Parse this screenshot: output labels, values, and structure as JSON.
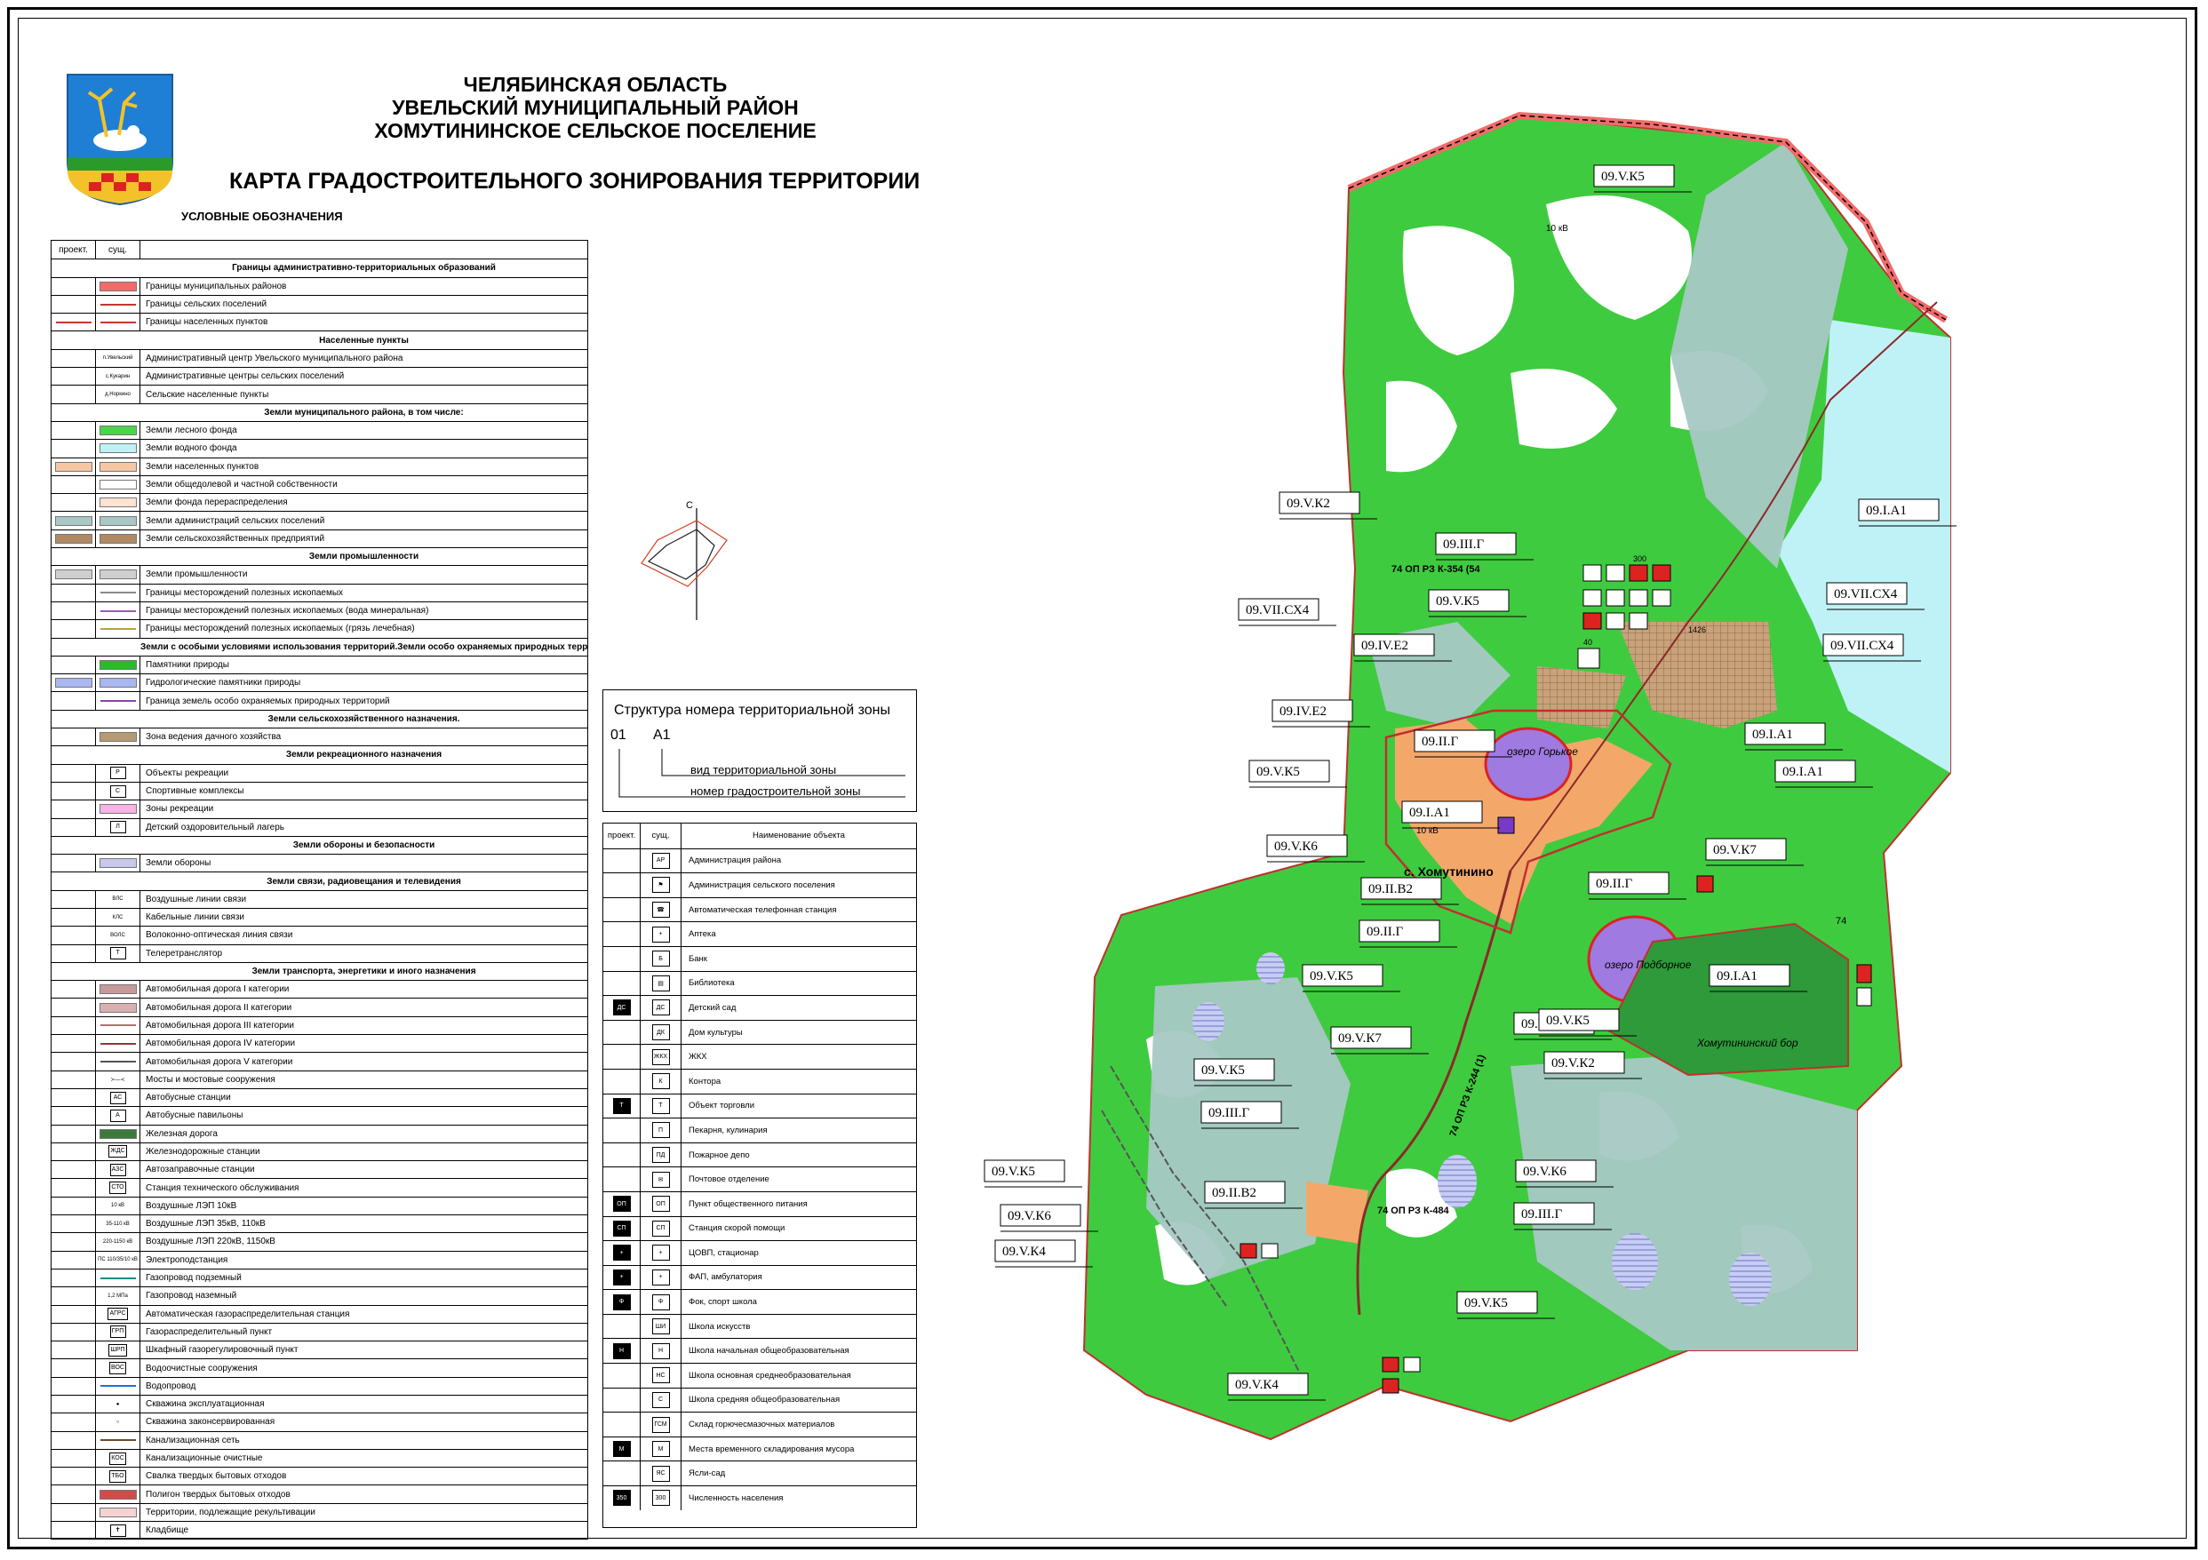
{
  "header": {
    "line1": "ЧЕЛЯБИНСКАЯ ОБЛАСТЬ",
    "line2": "УВЕЛЬСКИЙ МУНИЦИПАЛЬНЫЙ РАЙОН",
    "line3": "ХОМУТИНИНСКОЕ СЕЛЬСКОЕ ПОСЕЛЕНИЕ",
    "map_title": "КАРТА ГРАДОСТРОИТЕЛЬНОГО ЗОНИРОВАНИЯ ТЕРРИТОРИИ",
    "legend_caption": "УСЛОВНЫЕ ОБОЗНАЧЕНИЯ"
  },
  "legend": {
    "col_proj": "проект.",
    "col_exist": "сущ.",
    "rows": [
      {
        "type": "section",
        "label": "Границы административно-территориальных образований"
      },
      {
        "type": "item",
        "label": "Границы муниципальных районов",
        "sym": "swatch",
        "color": "#f26b6b"
      },
      {
        "type": "item",
        "label": "Границы сельских поселений",
        "sym": "line",
        "color": "#c0392b"
      },
      {
        "type": "item",
        "label": "Границы населенных пунктов",
        "sym": "line2",
        "color": "#c0392b"
      },
      {
        "type": "section",
        "label": "Населенные пункты"
      },
      {
        "type": "item",
        "label": "Административный центр Увельского муниципального района",
        "sym": "text",
        "text": "п.Увельский"
      },
      {
        "type": "item",
        "label": "Административные центры сельских поселений",
        "sym": "text",
        "text": "с.Кукарин"
      },
      {
        "type": "item",
        "label": "Сельские населенные пункты",
        "sym": "text",
        "text": "д.Норкино"
      },
      {
        "type": "section",
        "label": "Земли муниципального района, в том числе:"
      },
      {
        "type": "item",
        "label": "Земли лесного фонда",
        "sym": "swatch",
        "color": "#4cd44c"
      },
      {
        "type": "item",
        "label": "Земли водного фонда",
        "sym": "swatch",
        "color": "#bff2f6"
      },
      {
        "type": "item",
        "label": "Земли населенных пунктов",
        "sym": "swatch2",
        "color": "#f7c6a3"
      },
      {
        "type": "item",
        "label": "Земли общедолевой и частной собственности",
        "sym": "swatch",
        "color": "#ffffff"
      },
      {
        "type": "item",
        "label": "Земли фонда перераспределения",
        "sym": "swatch",
        "color": "#fde3d2"
      },
      {
        "type": "item",
        "label": "Земли администраций сельских поселений",
        "sym": "swatch2",
        "color": "#a7c8c4"
      },
      {
        "type": "item",
        "label": "Земли сельскохозяйственных предприятий",
        "sym": "swatch2",
        "color": "#b08a62"
      },
      {
        "type": "section",
        "label": "Земли промышленности"
      },
      {
        "type": "item",
        "label": "Земли промышленности",
        "sym": "swatch2",
        "color": "#cfcfcf"
      },
      {
        "type": "item",
        "label": "Границы месторождений полезных ископаемых",
        "sym": "line",
        "color": "#8a8a8a"
      },
      {
        "type": "item",
        "label": "Границы месторождений полезных ископаемых (вода минеральная)",
        "sym": "line",
        "color": "#9b59b6"
      },
      {
        "type": "item",
        "label": "Границы месторождений полезных ископаемых (грязь лечебная)",
        "sym": "line",
        "color": "#b7a33b"
      },
      {
        "type": "section",
        "label": "Земли с особыми условиями использования территорий.Земли особо охраняемых природных территорий."
      },
      {
        "type": "item",
        "label": "Памятники природы",
        "sym": "swatch",
        "color": "#2eb82e"
      },
      {
        "type": "item",
        "label": "Гидрологические памятники природы",
        "sym": "swatch2",
        "color": "#a9b8f2"
      },
      {
        "type": "item",
        "label": "Граница земель особо охраняемых природных территорий",
        "sym": "line",
        "color": "#8e44ad"
      },
      {
        "type": "section",
        "label": "Земли сельскохозяйственного назначения."
      },
      {
        "type": "item",
        "label": "Зона ведения дачного хозяйства",
        "sym": "swatch",
        "color": "#b79a73"
      },
      {
        "type": "section",
        "label": "Земли рекреационного назначения"
      },
      {
        "type": "item",
        "label": "Объекты рекреации",
        "sym": "icon",
        "text": "Р"
      },
      {
        "type": "item",
        "label": "Спортивные комплексы",
        "sym": "icon",
        "text": "С"
      },
      {
        "type": "item",
        "label": "Зоны рекреации",
        "sym": "swatch",
        "color": "#f6b3e3"
      },
      {
        "type": "item",
        "label": "Детский оздоровительный лагерь",
        "sym": "icon",
        "text": "Л"
      },
      {
        "type": "section",
        "label": "Земли обороны и безопасности"
      },
      {
        "type": "item",
        "label": "Земли обороны",
        "sym": "swatch",
        "color": "#c8c8ea"
      },
      {
        "type": "section",
        "label": "Земли связи, радиовещания и телевидения"
      },
      {
        "type": "item",
        "label": "Воздушные линии связи",
        "sym": "text",
        "text": "ВЛС"
      },
      {
        "type": "item",
        "label": "Кабельные линии связи",
        "sym": "text",
        "text": "КЛС"
      },
      {
        "type": "item",
        "label": "Волоконно-оптическая линия связи",
        "sym": "text",
        "text": "ВОЛС"
      },
      {
        "type": "item",
        "label": "Телеретранслятор",
        "sym": "icon",
        "text": "Т"
      },
      {
        "type": "section",
        "label": "Земли транспорта, энергетики и иного назначения"
      },
      {
        "type": "item",
        "label": "Автомобильная дорога I категории",
        "sym": "swatch",
        "color": "#c99a9a"
      },
      {
        "type": "item",
        "label": "Автомобильная дорога II категории",
        "sym": "swatch",
        "color": "#d9b0b0"
      },
      {
        "type": "item",
        "label": "Автомобильная дорога III категории",
        "sym": "line",
        "color": "#b07070"
      },
      {
        "type": "item",
        "label": "Автомобильная дорога IV категории",
        "sym": "line",
        "color": "#8b3a3a"
      },
      {
        "type": "item",
        "label": "Автомобильная дорога V категории",
        "sym": "line",
        "color": "#555555"
      },
      {
        "type": "item",
        "label": "Мосты и мостовые сооружения",
        "sym": "text",
        "text": "≻—≺"
      },
      {
        "type": "item",
        "label": "Автобусные станции",
        "sym": "icon",
        "text": "АС"
      },
      {
        "type": "item",
        "label": "Автобусные павильоны",
        "sym": "icon",
        "text": "А"
      },
      {
        "type": "item",
        "label": "Железная дорога",
        "sym": "swatch",
        "color": "#3c7a3c"
      },
      {
        "type": "item",
        "label": "Железнодорожные станции",
        "sym": "icon",
        "text": "ЖДС"
      },
      {
        "type": "item",
        "label": "Автозаправочные станции",
        "sym": "icon",
        "text": "АЗС"
      },
      {
        "type": "item",
        "label": "Станция технического обслуживания",
        "sym": "icon",
        "text": "СТО"
      },
      {
        "type": "item",
        "label": "Воздушные ЛЭП 10кВ",
        "sym": "text",
        "text": "10 кВ"
      },
      {
        "type": "item",
        "label": "Воздушные ЛЭП 35кВ, 110кВ",
        "sym": "text",
        "text": "35-110 кВ"
      },
      {
        "type": "item",
        "label": "Воздушные ЛЭП 220кВ, 1150кВ",
        "sym": "text",
        "text": "220-1150 кВ"
      },
      {
        "type": "item",
        "label": "Электроподстанция",
        "sym": "text",
        "text": "ПС 110/35/10 кВ"
      },
      {
        "type": "item",
        "label": "Газопровод подземный",
        "sym": "line",
        "color": "#1a8a8a"
      },
      {
        "type": "item",
        "label": "Газопровод наземный",
        "sym": "text",
        "text": "1,2 МПа"
      },
      {
        "type": "item",
        "label": "Автоматическая газораспределительная станция",
        "sym": "icon",
        "text": "АГРС"
      },
      {
        "type": "item",
        "label": "Газораспределительный пункт",
        "sym": "icon",
        "text": "ГРП"
      },
      {
        "type": "item",
        "label": "Шкафный газорегулировочный пункт",
        "sym": "icon",
        "text": "ШРП"
      },
      {
        "type": "item",
        "label": "Водоочистные сооружения",
        "sym": "icon",
        "text": "ВОС"
      },
      {
        "type": "item",
        "label": "Водопровод",
        "sym": "line",
        "color": "#1e6fd9"
      },
      {
        "type": "item",
        "label": "Скважина эксплуатационная",
        "sym": "text",
        "text": "●"
      },
      {
        "type": "item",
        "label": "Скважина законсервированная",
        "sym": "text",
        "text": "○"
      },
      {
        "type": "item",
        "label": "Канализационная сеть",
        "sym": "line",
        "color": "#6b4a2a"
      },
      {
        "type": "item",
        "label": "Канализационные очистные",
        "sym": "icon",
        "text": "КОС"
      },
      {
        "type": "item",
        "label": "Свалка твердых бытовых отходов",
        "sym": "icon",
        "text": "ТБО"
      },
      {
        "type": "item",
        "label": "Полигон твердых бытовых отходов",
        "sym": "swatch",
        "color": "#d24a4a"
      },
      {
        "type": "item",
        "label": "Территории, подлежащие рекультивации",
        "sym": "swatch",
        "color": "#f7d2d2"
      },
      {
        "type": "item",
        "label": "Кладбище",
        "sym": "icon",
        "text": "✝"
      }
    ]
  },
  "structure": {
    "title": "Структура номера территориальной зоны",
    "num1": "01",
    "num2": "А1",
    "desc1": "вид территориальной зоны",
    "desc2": "номер градостроительной зоны"
  },
  "objects": {
    "col_proj": "проект.",
    "col_exist": "сущ.",
    "col_name": "Наименование объекта",
    "rows": [
      {
        "label": "Администрация района",
        "exist": "АР",
        "proj": ""
      },
      {
        "label": "Администрация сельского поселения",
        "exist": "⚑",
        "proj": ""
      },
      {
        "label": "Автоматическая телефонная станция",
        "exist": "☎",
        "proj": ""
      },
      {
        "label": "Аптека",
        "exist": "+",
        "proj": ""
      },
      {
        "label": "Банк",
        "exist": "Б",
        "proj": ""
      },
      {
        "label": "Библиотека",
        "exist": "▤",
        "proj": ""
      },
      {
        "label": "Детский сад",
        "exist": "ДС",
        "proj": "ДС"
      },
      {
        "label": "Дом культуры",
        "exist": "ДК",
        "proj": ""
      },
      {
        "label": "ЖКХ",
        "exist": "ЖКХ",
        "proj": ""
      },
      {
        "label": "Контора",
        "exist": "К",
        "proj": ""
      },
      {
        "label": "Объект торговли",
        "exist": "Т",
        "proj": "Т"
      },
      {
        "label": "Пекарня, кулинария",
        "exist": "П",
        "proj": ""
      },
      {
        "label": "Пожарное депо",
        "exist": "ПД",
        "proj": ""
      },
      {
        "label": "Почтовое отделение",
        "exist": "✉",
        "proj": ""
      },
      {
        "label": "Пункт общественного питания",
        "exist": "ОП",
        "proj": "ОП"
      },
      {
        "label": "Станция скорой помощи",
        "exist": "СП",
        "proj": "СП"
      },
      {
        "label": "ЦОВП, стационар",
        "exist": "+",
        "proj": "+"
      },
      {
        "label": "ФАП, амбулатория",
        "exist": "+",
        "proj": "+"
      },
      {
        "label": "Фок, спорт школа",
        "exist": "Ф",
        "proj": "Ф"
      },
      {
        "label": "Школа искусств",
        "exist": "ШИ",
        "proj": ""
      },
      {
        "label": "Школа начальная общеобразовательная",
        "exist": "Н",
        "proj": "Н"
      },
      {
        "label": "Школа основная среднеобразовательная",
        "exist": "НС",
        "proj": ""
      },
      {
        "label": "Школа средняя общеобразовательная",
        "exist": "С",
        "proj": ""
      },
      {
        "label": "Склад горючесмазочных материалов",
        "exist": "ГСМ",
        "proj": ""
      },
      {
        "label": "Места временного складирования мусора",
        "exist": "М",
        "proj": "М"
      },
      {
        "label": "Ясли-сад",
        "exist": "ЯС",
        "proj": ""
      },
      {
        "label": "Численность населения",
        "exist": "300",
        "proj": "350"
      }
    ]
  },
  "compass": {
    "north": "С"
  },
  "map": {
    "zone_labels": [
      "09.V.К5",
      "09.V.К2",
      "09.III.Г",
      "09.V.К5",
      "09.VII.СХ4",
      "09.IV.Е2",
      "09.IV.Е2",
      "09.II.Г",
      "09.V.К5",
      "09.I.А1",
      "09.V.К6",
      "09.II.В2",
      "09.II.Г",
      "09.V.К5",
      "09.V.К7",
      "09.V.К5",
      "09.III.Г",
      "09.II.В2",
      "09.V.К5",
      "09.V.К6",
      "09.V.К4",
      "09.V.К4",
      "09.V.К5",
      "09.I.А1",
      "09.VII.СХ4",
      "09.VII.СХ4",
      "09.I.А1",
      "09.I.А1",
      "09.V.К7",
      "09.II.Г",
      "09.I.А1",
      "09.V.К5",
      "09.V.К2",
      "09.V.К6",
      "09.III.Г",
      "09.V.К5"
    ],
    "village": "с. Хомутинино",
    "lake1": "озеро Горькое",
    "lake2": "озеро Подборное",
    "forest": "Хомутининский бор",
    "road1": "74 ОП РЗ К-354 (54",
    "road2": "74 ОП РЗ К-484",
    "road3": "74 ОП РЗ К-244 (1)",
    "road4": "74",
    "kv1": "10 кВ",
    "kv2": "10 кВ",
    "pop1": "300",
    "pop2": "1426",
    "pop3": "40"
  },
  "colors": {
    "forest": "#44d044",
    "forest_dark": "#2aa02a",
    "water": "#bff2f6",
    "settlement": "#f7c6a3",
    "admin": "#a7c8c4",
    "district_border": "#f26b6b",
    "road": "#8b2a2a"
  }
}
